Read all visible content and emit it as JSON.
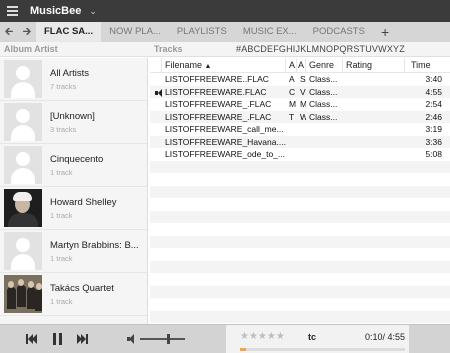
{
  "app": {
    "title": "MusicBee"
  },
  "tabs": [
    {
      "label": "FLAC SA..."
    },
    {
      "label": "NOW PLA..."
    },
    {
      "label": "PLAYLISTS"
    },
    {
      "label": "MUSIC EX..."
    },
    {
      "label": "PODCASTS"
    }
  ],
  "tab_add_label": "+",
  "subheader": {
    "album_artist_label": "Album Artist",
    "tracks_label": "Tracks",
    "alpha_index": "#ABCDEFGHIJKLMNOPQRSTUVWXYZ"
  },
  "artists": [
    {
      "name": "All Artists",
      "count": "7 tracks",
      "thumb": "placeholder"
    },
    {
      "name": "[Unknown]",
      "count": "3 tracks",
      "thumb": "placeholder"
    },
    {
      "name": "Cinquecento",
      "count": "1 track",
      "thumb": "placeholder"
    },
    {
      "name": "Howard Shelley",
      "count": "1 track",
      "thumb": "portrait-photo"
    },
    {
      "name": "Martyn Brabbins: B...",
      "count": "1 track",
      "thumb": "placeholder"
    },
    {
      "name": "Takács Quartet",
      "count": "1 track",
      "thumb": "group-photo"
    }
  ],
  "table": {
    "columns": [
      "",
      "Filename",
      "A...",
      "A",
      "Genre",
      "Rating",
      "Time"
    ],
    "sort_indicator": "▲",
    "rows": [
      {
        "playing": "",
        "filename": "LISTOFFREEWARE..FLAC",
        "a1": "A",
        "a2": "S",
        "genre": "Class...",
        "rating": "",
        "time": "3:40"
      },
      {
        "playing": "speaker",
        "filename": "LISTOFFREEWARE.FLAC",
        "a1": "C",
        "a2": "V",
        "genre": "Class...",
        "rating": "",
        "time": "4:55"
      },
      {
        "playing": "",
        "filename": "LISTOFFREEWARE_.FLAC",
        "a1": "M",
        "a2": "M",
        "genre": "Class...",
        "rating": "",
        "time": "2:54"
      },
      {
        "playing": "",
        "filename": "LISTOFFREEWARE_.FLAC",
        "a1": "T",
        "a2": "W",
        "genre": "Class...",
        "rating": "",
        "time": "2:46"
      },
      {
        "playing": "",
        "filename": "LISTOFFREEWARE_call_me...",
        "a1": "",
        "a2": "",
        "genre": "",
        "rating": "",
        "time": "3:19"
      },
      {
        "playing": "",
        "filename": "LISTOFFREEWARE_Havana....",
        "a1": "",
        "a2": "",
        "genre": "",
        "rating": "",
        "time": "3:36"
      },
      {
        "playing": "",
        "filename": "LISTOFFREEWARE_ode_to_...",
        "a1": "",
        "a2": "",
        "genre": "",
        "rating": "",
        "time": "5:08"
      }
    ],
    "empty_rows": 13
  },
  "player": {
    "volume_fraction": 0.6,
    "rating_stars": "★★★★★",
    "now_playing_title": "tc",
    "time_display": "0:10/ 4:55",
    "progress_fraction": 0.034
  },
  "colors": {
    "titlebar": "#3b3b3b",
    "tabbar": "#d6d6d6",
    "progress": "#f0a648"
  }
}
